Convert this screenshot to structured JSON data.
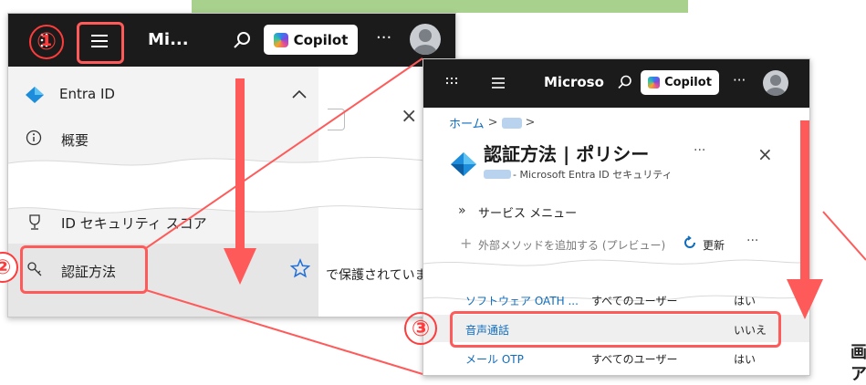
{
  "left_panel": {
    "topbar": {
      "app_name": "Mi...",
      "copilot_label": "Copilot",
      "more": "···"
    },
    "entra": {
      "label": "Entra ID"
    },
    "items": [
      {
        "label": "概要"
      },
      {
        "label": "ID セキュリティ スコア"
      },
      {
        "label": "認証方法"
      }
    ],
    "partial_text": "で保護されていま",
    "close": "×"
  },
  "right_panel": {
    "topbar": {
      "app_name": "Microso",
      "copilot_label": "Copilot",
      "more": "···"
    },
    "breadcrumb": {
      "home": "ホーム",
      "sep": ">"
    },
    "title": "認証方法 | ポリシー",
    "subtitle": "- Microsoft Entra ID セキュリティ",
    "title_more": "···",
    "close": "×",
    "service_menu": "サービス メニュー",
    "toolbar": {
      "add": "外部メソッドを追加する (プレビュー)",
      "refresh": "更新",
      "more": "···"
    },
    "rows": [
      {
        "name": "ソフトウェア OATH ...",
        "target": "すべてのユーザー",
        "enabled": "はい"
      },
      {
        "name": "音声通話",
        "target": "",
        "enabled": "いいえ"
      },
      {
        "name": "メール OTP",
        "target": "すべてのユーザー",
        "enabled": "はい"
      }
    ]
  },
  "steps": {
    "one": "①",
    "two": "②",
    "three": "③"
  },
  "right_edge_text": {
    "line1": "画",
    "line2": "ア"
  },
  "colors": {
    "annotation_red": "#ff5a5a",
    "link_blue": "#0f6cbd",
    "banner_green": "#a9d18e"
  }
}
